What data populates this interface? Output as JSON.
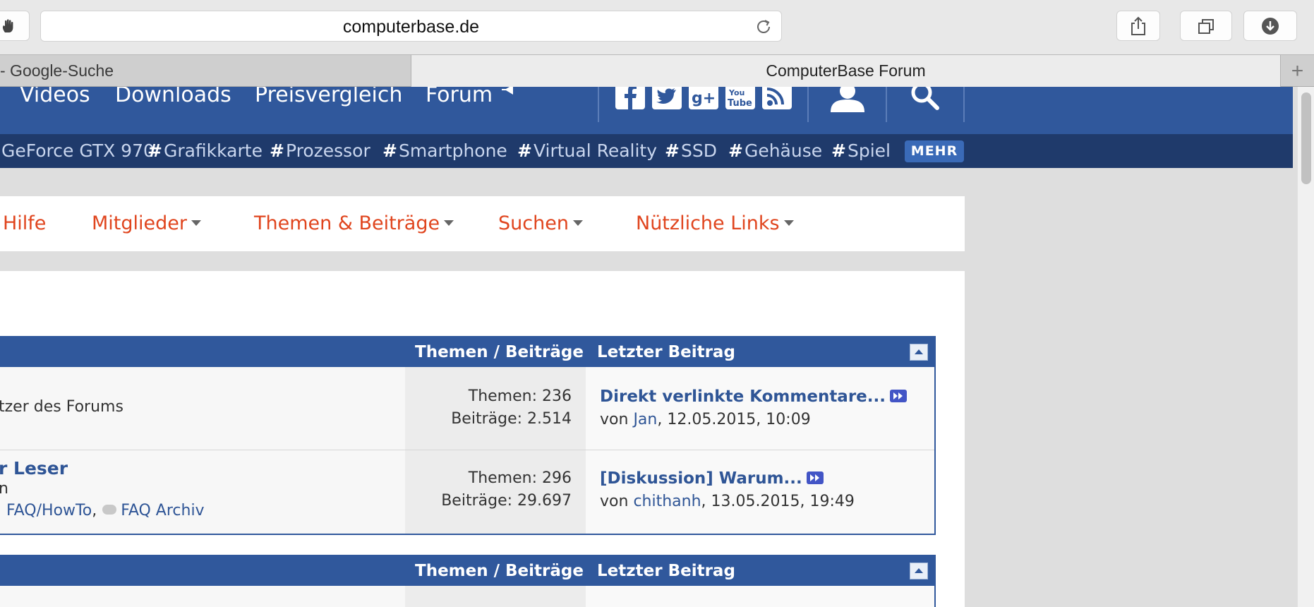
{
  "browser": {
    "url": "computerbase.de",
    "tabs": [
      {
        "label": "- Google-Suche"
      },
      {
        "label": "ComputerBase Forum"
      }
    ],
    "icons": {
      "hand": "hand-icon",
      "reload": "reload-icon",
      "share": "share-icon",
      "tabs": "tabs-icon",
      "download": "download-icon",
      "new_tab": "+"
    }
  },
  "site_nav": {
    "links": [
      "Videos",
      "Downloads",
      "Preisvergleich",
      "Forum"
    ],
    "social": [
      "facebook-icon",
      "twitter-icon",
      "googleplus-icon",
      "youtube-icon",
      "rss-icon"
    ],
    "user_icon": "user-icon",
    "search_icon": "search-icon"
  },
  "tags": {
    "items": [
      {
        "hash": "",
        "label": "GeForce GTX 970"
      },
      {
        "hash": "#",
        "label": "Grafikkarte"
      },
      {
        "hash": "#",
        "label": "Prozessor"
      },
      {
        "hash": "#",
        "label": "Smartphone"
      },
      {
        "hash": "#",
        "label": "Virtual Reality"
      },
      {
        "hash": "#",
        "label": "SSD"
      },
      {
        "hash": "#",
        "label": "Gehäuse"
      },
      {
        "hash": "#",
        "label": "Spiel"
      }
    ],
    "more_label": "MEHR"
  },
  "forum_nav": {
    "items": [
      {
        "label": "Hilfe",
        "dropdown": false
      },
      {
        "label": "Mitglieder",
        "dropdown": true
      },
      {
        "label": "Themen & Beiträge",
        "dropdown": true
      },
      {
        "label": "Suchen",
        "dropdown": true
      },
      {
        "label": "Nützliche Links",
        "dropdown": true
      }
    ]
  },
  "forum_blocks": [
    {
      "header": {
        "topics_posts": "Themen / Beiträge",
        "last_post": "Letzter Beitrag"
      },
      "rows": [
        {
          "title": "",
          "description": "tzer des Forums",
          "links_prefix": "",
          "link_1": "",
          "link_2": "",
          "topics": "Themen: 236",
          "posts": "Beiträge: 2.514",
          "last_title": "Direkt verlinkte Kommentare...",
          "last_by": "von",
          "last_user": "Jan",
          "last_date": ", 12.05.2015, 10:09"
        },
        {
          "title": "r Leser",
          "description": "n",
          "link_1": "FAQ/HowTo",
          "link_2": "FAQ Archiv",
          "topics": "Themen: 296",
          "posts": "Beiträge: 29.697",
          "last_title": "[Diskussion] Warum...",
          "last_by": "von",
          "last_user": "chithanh",
          "last_date": ", 13.05.2015, 19:49"
        }
      ]
    },
    {
      "header": {
        "topics_posts": "Themen / Beiträge",
        "last_post": "Letzter Beitrag"
      },
      "rows": []
    }
  ],
  "colors": {
    "site_blue": "#30589c",
    "tag_bar": "#1f3a6b",
    "accent_orange": "#e0451e",
    "link_blue": "#2f5596"
  }
}
